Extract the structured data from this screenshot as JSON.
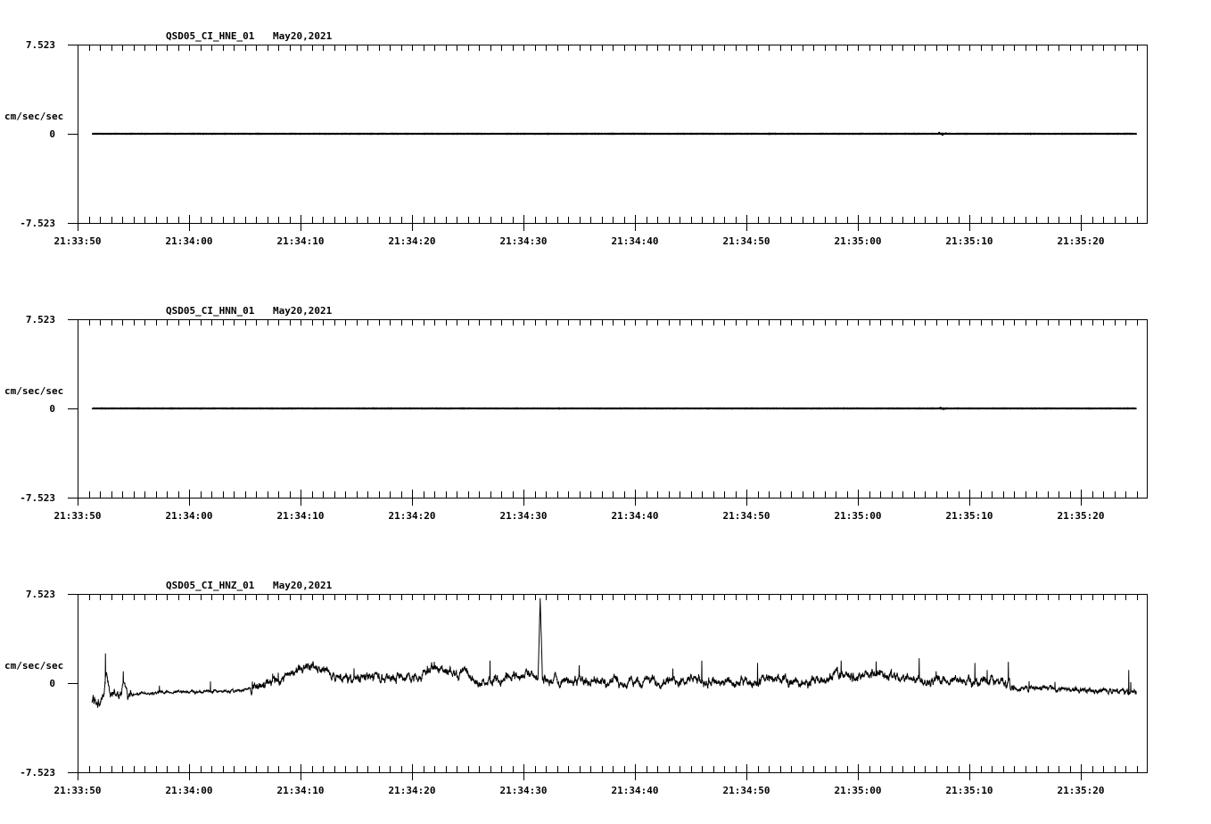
{
  "chart_data": [
    {
      "type": "line",
      "title": "QSD05_CI_HNE_01",
      "date": "May20,2021",
      "ylabel": "cm/sec/sec",
      "ylim": [
        -7.523,
        7.523
      ],
      "ytick_labels": [
        "7.523",
        "0",
        "-7.523"
      ],
      "xlabel": "",
      "x_units": "seconds after 21:33:50",
      "xlim": [
        0,
        96
      ],
      "xtick_labels": [
        "21:33:50",
        "21:34:00",
        "21:34:10",
        "21:34:20",
        "21:34:30",
        "21:34:40",
        "21:34:50",
        "21:35:00",
        "21:35:10",
        "21:35:20"
      ],
      "series": [
        {
          "name": "HNE",
          "points": [
            [
              1.3,
              0
            ],
            [
              95,
              0
            ]
          ],
          "events": [
            [
              77.3,
              0.15
            ],
            [
              77.6,
              -0.15
            ],
            [
              77.9,
              0.1
            ]
          ]
        }
      ]
    },
    {
      "type": "line",
      "title": "QSD05_CI_HNN_01",
      "date": "May20,2021",
      "ylabel": "cm/sec/sec",
      "ylim": [
        -7.523,
        7.523
      ],
      "ytick_labels": [
        "7.523",
        "0",
        "-7.523"
      ],
      "xlabel": "",
      "x_units": "seconds after 21:33:50",
      "xlim": [
        0,
        96
      ],
      "xtick_labels": [
        "21:33:50",
        "21:34:00",
        "21:34:10",
        "21:34:20",
        "21:34:30",
        "21:34:40",
        "21:34:50",
        "21:35:00",
        "21:35:10",
        "21:35:20"
      ],
      "series": [
        {
          "name": "HNN",
          "points": [
            [
              1.3,
              0
            ],
            [
              95,
              0
            ]
          ],
          "events": [
            [
              77.4,
              0.12
            ],
            [
              77.7,
              -0.12
            ],
            [
              79.0,
              0.08
            ]
          ]
        }
      ]
    },
    {
      "type": "line",
      "title": "QSD05_CI_HNZ_01",
      "date": "May20,2021",
      "ylabel": "cm/sec/sec",
      "ylim": [
        -7.523,
        7.523
      ],
      "ytick_labels": [
        "7.523",
        "0",
        "-7.523"
      ],
      "xlabel": "",
      "x_units": "seconds after 21:33:50",
      "xlim": [
        0,
        96
      ],
      "xtick_labels": [
        "21:33:50",
        "21:34:00",
        "21:34:10",
        "21:34:20",
        "21:34:30",
        "21:34:40",
        "21:34:50",
        "21:35:00",
        "21:35:10",
        "21:35:20"
      ],
      "series": [
        {
          "name": "HNZ",
          "points": [
            [
              1.3,
              -1.5
            ],
            [
              2.3,
              -1.4
            ],
            [
              2.6,
              0.9
            ],
            [
              3,
              -1.0
            ],
            [
              3.9,
              -1.0
            ],
            [
              4.1,
              0.6
            ],
            [
              4.5,
              -1.0
            ],
            [
              6,
              -0.8
            ],
            [
              10,
              -0.75
            ],
            [
              14,
              -0.7
            ],
            [
              15,
              -0.55
            ],
            [
              16,
              -0.4
            ],
            [
              17,
              -0.1
            ],
            [
              18,
              0.3
            ],
            [
              19,
              0.8
            ],
            [
              20,
              1.3
            ],
            [
              21,
              1.5
            ],
            [
              22,
              1.2
            ],
            [
              23,
              0.5
            ],
            [
              24,
              0.3
            ],
            [
              26,
              0.6
            ],
            [
              28,
              0.6
            ],
            [
              30,
              0.6
            ],
            [
              31,
              0.8
            ],
            [
              32,
              1.3
            ],
            [
              33,
              1.1
            ],
            [
              34,
              1.0
            ],
            [
              35,
              0.6
            ],
            [
              36,
              -0.1
            ],
            [
              37,
              0.2
            ],
            [
              38,
              0.4
            ],
            [
              39,
              0.6
            ],
            [
              40,
              0.9
            ],
            [
              41,
              0.6
            ],
            [
              41.3,
              0.6
            ],
            [
              41.5,
              7.4
            ],
            [
              41.7,
              0.1
            ],
            [
              42,
              0.1
            ],
            [
              44,
              0.3
            ],
            [
              46,
              0.2
            ],
            [
              50,
              0.1
            ],
            [
              55,
              0.3
            ],
            [
              60,
              0.0
            ],
            [
              63,
              0.4
            ],
            [
              65,
              0.0
            ],
            [
              67,
              0.2
            ],
            [
              68,
              0.8
            ],
            [
              70,
              0.6
            ],
            [
              72,
              0.8
            ],
            [
              75,
              0.4
            ],
            [
              78,
              0.2
            ],
            [
              80,
              0.1
            ],
            [
              83,
              0.1
            ],
            [
              84,
              -0.5
            ],
            [
              86,
              -0.45
            ],
            [
              88,
              -0.45
            ],
            [
              90,
              -0.55
            ],
            [
              92,
              -0.65
            ],
            [
              94,
              -0.75
            ],
            [
              95,
              -0.7
            ]
          ],
          "events": [
            [
              2.5,
              2.5
            ],
            [
              4.1,
              1.0
            ],
            [
              17.5,
              0.8
            ],
            [
              32,
              1.8
            ],
            [
              37,
              1.9
            ],
            [
              45,
              1.5
            ],
            [
              56,
              1.9
            ],
            [
              61,
              1.7
            ],
            [
              68.5,
              1.9
            ],
            [
              75.5,
              2.1
            ],
            [
              80.5,
              1.7
            ],
            [
              83.5,
              1.8
            ],
            [
              94.3,
              1.1
            ]
          ]
        }
      ]
    }
  ]
}
